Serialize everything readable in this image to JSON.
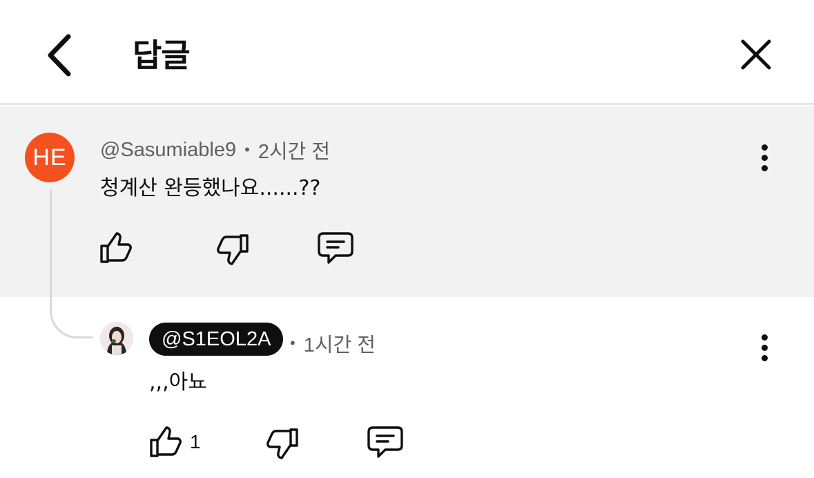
{
  "header": {
    "title": "답글"
  },
  "parent_comment": {
    "avatar_initials": "HE",
    "avatar_color": "#f4511e",
    "author": "@Sasumiable9",
    "separator": "•",
    "time": "2시간 전",
    "text": "청계산 완등했나요......??"
  },
  "reply": {
    "author": "@S1EOL2A",
    "separator": "•",
    "time": "1시간 전",
    "text": ",,,아뇨",
    "like_count": "1"
  },
  "icons": {
    "back": "chevron-left-icon",
    "close": "close-icon",
    "more": "more-vertical-icon",
    "like": "thumbs-up-icon",
    "dislike": "thumbs-down-icon",
    "reply": "comment-icon"
  }
}
